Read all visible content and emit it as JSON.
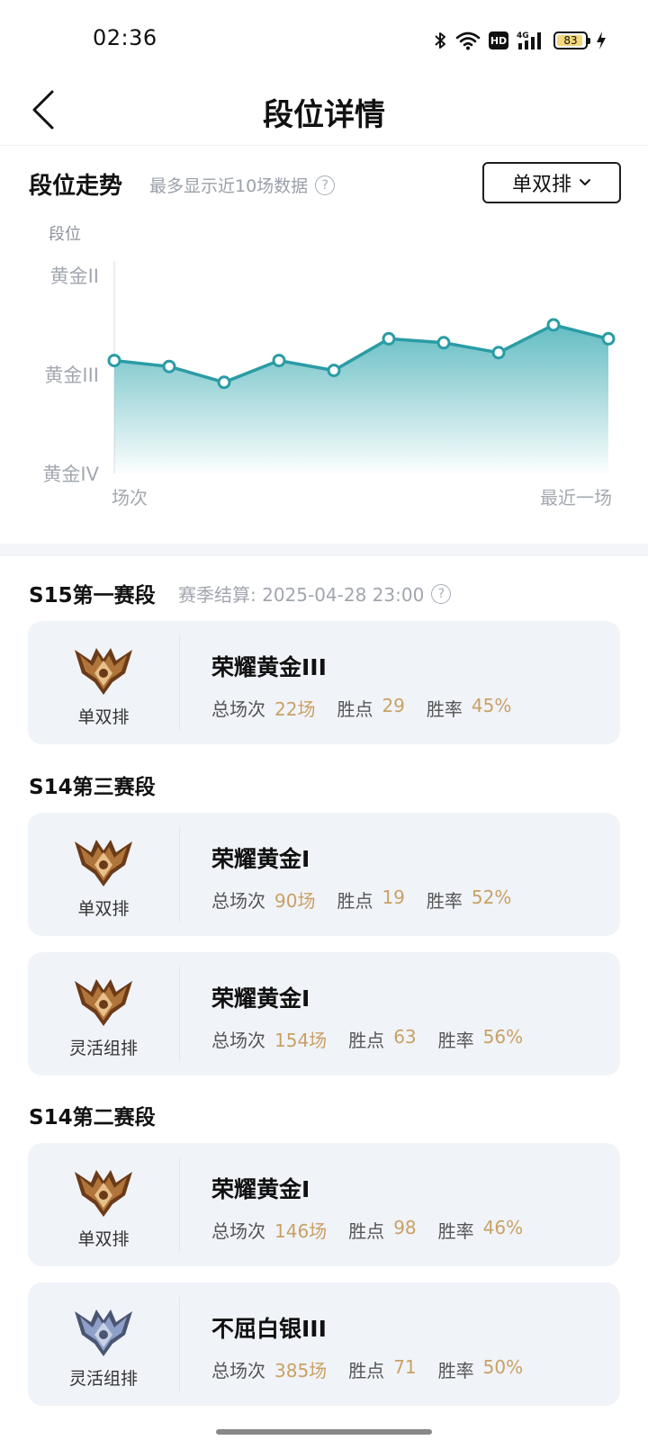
{
  "status_bar": {
    "time": "02:36",
    "battery_level": "83"
  },
  "header": {
    "title": "段位详情"
  },
  "trend": {
    "title": "段位走势",
    "subtitle": "最多显示近10场数据",
    "mode_select": "单双排"
  },
  "chart_data": {
    "type": "area",
    "ylabel": "段位",
    "y_ticks": [
      "黄金II",
      "黄金III",
      "黄金IV"
    ],
    "x_start_label": "场次",
    "x_end_label": "最近一场",
    "ylim_levels": [
      "黄金IV",
      "黄金II"
    ],
    "series": [
      {
        "values": [
          0.57,
          0.54,
          0.46,
          0.57,
          0.52,
          0.68,
          0.66,
          0.61,
          0.75,
          0.68
        ]
      }
    ],
    "line_color": "#2a9ca5",
    "fill_color": "#6fc3c8"
  },
  "seasons": [
    {
      "title": "S15第一赛段",
      "settle": "赛季结算: 2025-04-28 23:00",
      "cards": [
        {
          "queue": "单双排",
          "rank": "荣耀黄金III",
          "games_label": "总场次",
          "games": "22场",
          "points_label": "胜点",
          "points": "29",
          "winrate_label": "胜率",
          "winrate": "45%",
          "badge": "gold"
        }
      ]
    },
    {
      "title": "S14第三赛段",
      "cards": [
        {
          "queue": "单双排",
          "rank": "荣耀黄金I",
          "games_label": "总场次",
          "games": "90场",
          "points_label": "胜点",
          "points": "19",
          "winrate_label": "胜率",
          "winrate": "52%",
          "badge": "gold"
        },
        {
          "queue": "灵活组排",
          "rank": "荣耀黄金I",
          "games_label": "总场次",
          "games": "154场",
          "points_label": "胜点",
          "points": "63",
          "winrate_label": "胜率",
          "winrate": "56%",
          "badge": "gold"
        }
      ]
    },
    {
      "title": "S14第二赛段",
      "cards": [
        {
          "queue": "单双排",
          "rank": "荣耀黄金I",
          "games_label": "总场次",
          "games": "146场",
          "points_label": "胜点",
          "points": "98",
          "winrate_label": "胜率",
          "winrate": "46%",
          "badge": "gold"
        },
        {
          "queue": "灵活组排",
          "rank": "不屈白银III",
          "games_label": "总场次",
          "games": "385场",
          "points_label": "胜点",
          "points": "71",
          "winrate_label": "胜率",
          "winrate": "50%",
          "badge": "silver"
        }
      ]
    }
  ]
}
